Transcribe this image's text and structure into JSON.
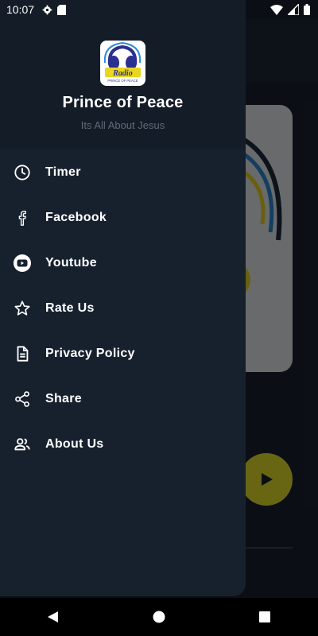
{
  "status_bar": {
    "time": "10:07"
  },
  "drawer": {
    "app_title": "Prince of Peace",
    "app_subtitle": "Its All About Jesus",
    "logo_text": "Radio",
    "logo_subtext": "PRINCE OF PEACE",
    "items": [
      {
        "label": "Timer",
        "icon": "clock-icon"
      },
      {
        "label": "Facebook",
        "icon": "facebook-icon"
      },
      {
        "label": "Youtube",
        "icon": "youtube-icon"
      },
      {
        "label": "Rate Us",
        "icon": "star-icon"
      },
      {
        "label": "Privacy Policy",
        "icon": "document-icon"
      },
      {
        "label": "Share",
        "icon": "share-icon"
      },
      {
        "label": "About Us",
        "icon": "people-icon"
      }
    ]
  },
  "colors": {
    "drawer_bg": "#17212e",
    "header_bg": "#141c27",
    "play_button": "#e6e32a"
  }
}
